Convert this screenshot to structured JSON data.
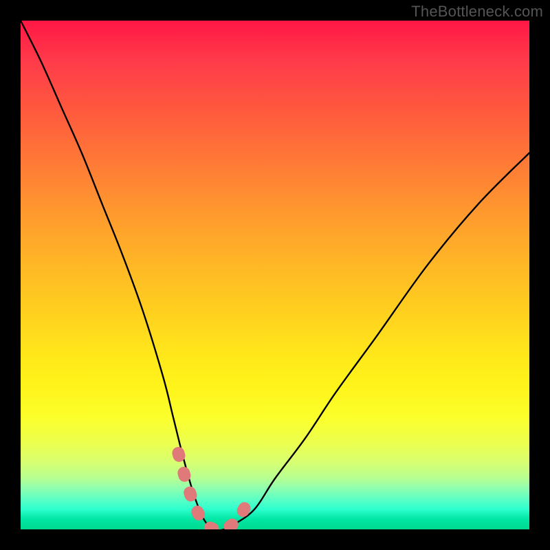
{
  "watermark": "TheBottleneck.com",
  "colors": {
    "frame": "#000000",
    "curve": "#000000",
    "optimal_highlight": "#e07a7a",
    "gradient_top": "#ff1744",
    "gradient_bottom": "#00d98f"
  },
  "chart_data": {
    "type": "line",
    "title": "",
    "xlabel": "",
    "ylabel": "",
    "xlim": [
      0,
      100
    ],
    "ylim": [
      0,
      100
    ],
    "grid": false,
    "legend": false,
    "notes": "V-shaped bottleneck curve overlaid on red→yellow→green vertical gradient background. Lower y = better (green). Pink dashed segment near the trough marks the optimal range.",
    "series": [
      {
        "name": "bottleneck_curve",
        "x": [
          0,
          4,
          8,
          12,
          16,
          20,
          24,
          28,
          30,
          32,
          34,
          36,
          38,
          40,
          42,
          46,
          50,
          56,
          62,
          70,
          80,
          90,
          100
        ],
        "y": [
          100,
          92,
          83,
          74,
          64,
          54,
          43,
          30,
          22,
          14,
          7,
          2,
          0,
          0,
          1,
          4,
          10,
          18,
          27,
          38,
          52,
          64,
          74
        ]
      },
      {
        "name": "optimal_range",
        "x": [
          31,
          33,
          35,
          37,
          39,
          41,
          43,
          45
        ],
        "y": [
          15,
          8,
          3,
          0.5,
          0,
          0.5,
          2.5,
          6
        ]
      }
    ],
    "optimal_x_range": [
      31,
      45
    ]
  }
}
